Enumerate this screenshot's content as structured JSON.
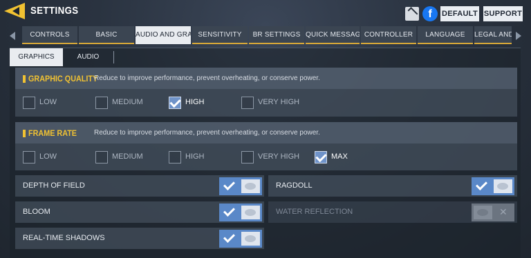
{
  "header": {
    "title": "SETTINGS",
    "default_label": "DEFAULT",
    "support_label": "SUPPORT",
    "facebook_glyph": "f"
  },
  "tabs": [
    {
      "label": "CONTROLS",
      "active": false
    },
    {
      "label": "BASIC",
      "active": false
    },
    {
      "label": "AUDIO AND GRAPHICS",
      "active": true
    },
    {
      "label": "SENSITIVITY",
      "active": false
    },
    {
      "label": "BR SETTINGS",
      "active": false
    },
    {
      "label": "QUICK MESSAGE",
      "active": false
    },
    {
      "label": "CONTROLLER",
      "active": false
    },
    {
      "label": "LANGUAGE",
      "active": false
    },
    {
      "label": "LEGAL AND PI",
      "active": false
    }
  ],
  "subtabs": [
    {
      "label": "GRAPHICS",
      "active": true
    },
    {
      "label": "AUDIO",
      "active": false
    }
  ],
  "graphic_quality": {
    "title": "GRAPHIC QUALITY",
    "description": "Reduce to improve performance, prevent overheating, or conserve power.",
    "options": [
      {
        "label": "LOW",
        "checked": false
      },
      {
        "label": "MEDIUM",
        "checked": false
      },
      {
        "label": "HIGH",
        "checked": true
      },
      {
        "label": "VERY HIGH",
        "checked": false
      }
    ]
  },
  "frame_rate": {
    "title": "FRAME RATE",
    "description": "Reduce to improve performance, prevent overheating, or conserve power.",
    "options": [
      {
        "label": "LOW",
        "checked": false
      },
      {
        "label": "MEDIUM",
        "checked": false
      },
      {
        "label": "HIGH",
        "checked": false
      },
      {
        "label": "VERY HIGH",
        "checked": false
      },
      {
        "label": "MAX",
        "checked": true
      }
    ]
  },
  "toggles": {
    "depth_of_field": {
      "label": "DEPTH OF FIELD",
      "on": true,
      "enabled": true
    },
    "ragdoll": {
      "label": "RAGDOLL",
      "on": true,
      "enabled": true
    },
    "bloom": {
      "label": "BLOOM",
      "on": true,
      "enabled": true
    },
    "water_reflection": {
      "label": "WATER REFLECTION",
      "on": false,
      "enabled": false,
      "off_glyph": "✕"
    },
    "real_time_shadows": {
      "label": "REAL-TIME SHADOWS",
      "on": true,
      "enabled": true
    }
  },
  "colors": {
    "accent": "#f1c232",
    "toggle_on": "#5a88c8",
    "checkbox_on": "#6f93c9"
  }
}
